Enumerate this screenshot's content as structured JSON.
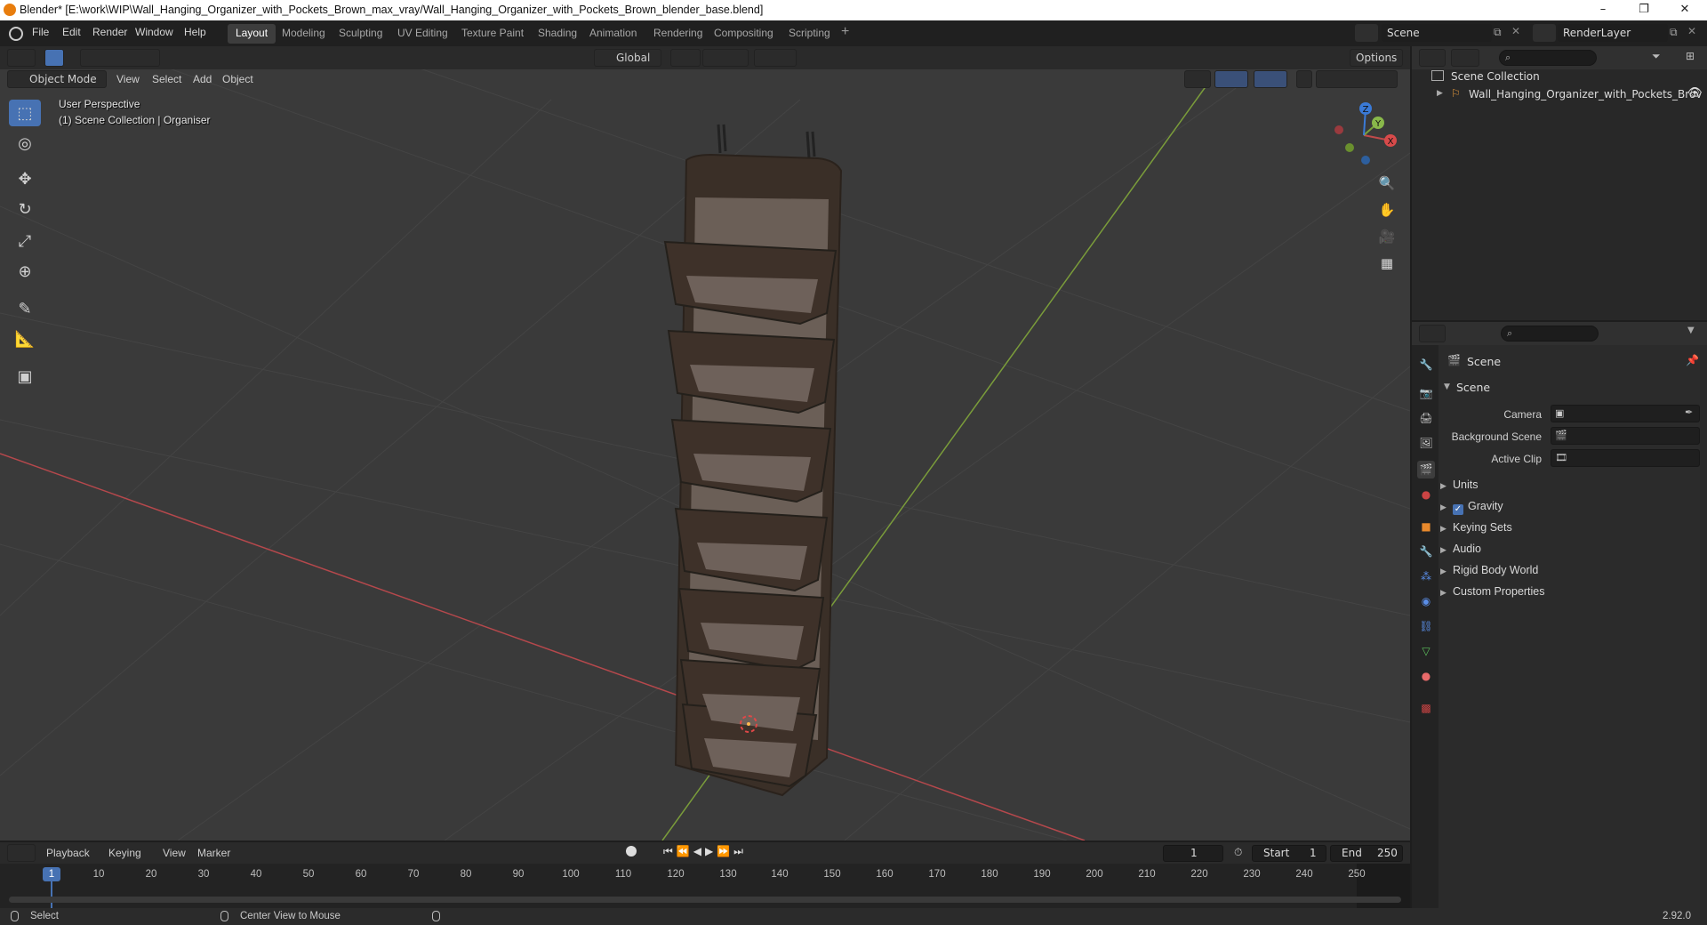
{
  "window": {
    "title": "Blender* [E:\\work\\WIP\\Wall_Hanging_Organizer_with_Pockets_Brown_max_vray/Wall_Hanging_Organizer_with_Pockets_Brown_blender_base.blend]",
    "minimize": "–",
    "maximize": "❐",
    "close": "✕"
  },
  "menu": [
    "File",
    "Edit",
    "Render",
    "Window",
    "Help"
  ],
  "workspaces": [
    {
      "label": "Layout",
      "active": true
    },
    {
      "label": "Modeling"
    },
    {
      "label": "Sculpting"
    },
    {
      "label": "UV Editing"
    },
    {
      "label": "Texture Paint"
    },
    {
      "label": "Shading"
    },
    {
      "label": "Animation"
    },
    {
      "label": "Rendering"
    },
    {
      "label": "Compositing"
    },
    {
      "label": "Scripting"
    }
  ],
  "add_workspace": "+",
  "scene_selector": {
    "value": "Scene"
  },
  "render_layer": {
    "value": "RenderLayer"
  },
  "viewport": {
    "mode": "Object Mode",
    "menus": [
      "View",
      "Select",
      "Add",
      "Object"
    ],
    "transform_orientation": "Global",
    "options_label": "Options",
    "overlay_line1": "User Perspective",
    "overlay_line2": "(1) Scene Collection | Organiser",
    "gizmo": {
      "x": "X",
      "y": "Y",
      "z": "Z"
    }
  },
  "outliner": {
    "root": "Scene Collection",
    "items": [
      {
        "label": "Wall_Hanging_Organizer_with_Pockets_Brov"
      }
    ]
  },
  "properties": {
    "context": "Scene",
    "panel_title": "Scene",
    "fields": [
      {
        "label": "Camera",
        "value": ""
      },
      {
        "label": "Background Scene",
        "value": ""
      },
      {
        "label": "Active Clip",
        "value": ""
      }
    ],
    "subpanels": [
      {
        "label": "Units"
      },
      {
        "label": "Gravity",
        "checkbox": true
      },
      {
        "label": "Keying Sets"
      },
      {
        "label": "Audio"
      },
      {
        "label": "Rigid Body World"
      },
      {
        "label": "Custom Properties"
      }
    ]
  },
  "timeline": {
    "menus": [
      "Playback",
      "Keying",
      "View",
      "Marker"
    ],
    "current_frame": "1",
    "start_label": "Start",
    "start": "1",
    "end_label": "End",
    "end": "250",
    "ticks": [
      "1",
      "10",
      "20",
      "30",
      "40",
      "50",
      "60",
      "70",
      "80",
      "90",
      "100",
      "110",
      "120",
      "130",
      "140",
      "150",
      "160",
      "170",
      "180",
      "190",
      "200",
      "210",
      "220",
      "230",
      "240",
      "250"
    ]
  },
  "statusbar": {
    "select": "Select",
    "center_view": "Center View to Mouse",
    "version": "2.92.0"
  },
  "colors": {
    "accent": "#4772b3",
    "x_axis": "#c04a4a",
    "y_axis": "#7aa33a",
    "z_axis": "#3a7ad6",
    "organizer": "#3a2f27"
  }
}
